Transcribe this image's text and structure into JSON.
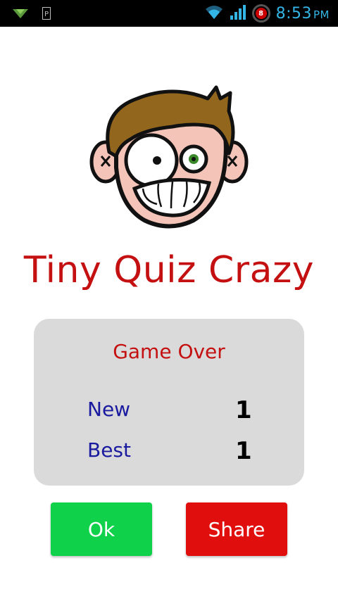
{
  "status_bar": {
    "time": "8:53",
    "ampm": "PM",
    "battery_level": "8",
    "icons": [
      "download-icon",
      "parking-icon",
      "wifi-icon",
      "signal-icon",
      "battery-icon"
    ]
  },
  "app": {
    "title": "Tiny Quiz Crazy",
    "title_color": "#c41010"
  },
  "score_card": {
    "heading": "Game Over",
    "rows": [
      {
        "label": "New",
        "value": "1"
      },
      {
        "label": "Best",
        "value": "1"
      }
    ]
  },
  "buttons": {
    "ok_label": "Ok",
    "share_label": "Share",
    "ok_color": "#10d24a",
    "share_color": "#e10e0e"
  }
}
